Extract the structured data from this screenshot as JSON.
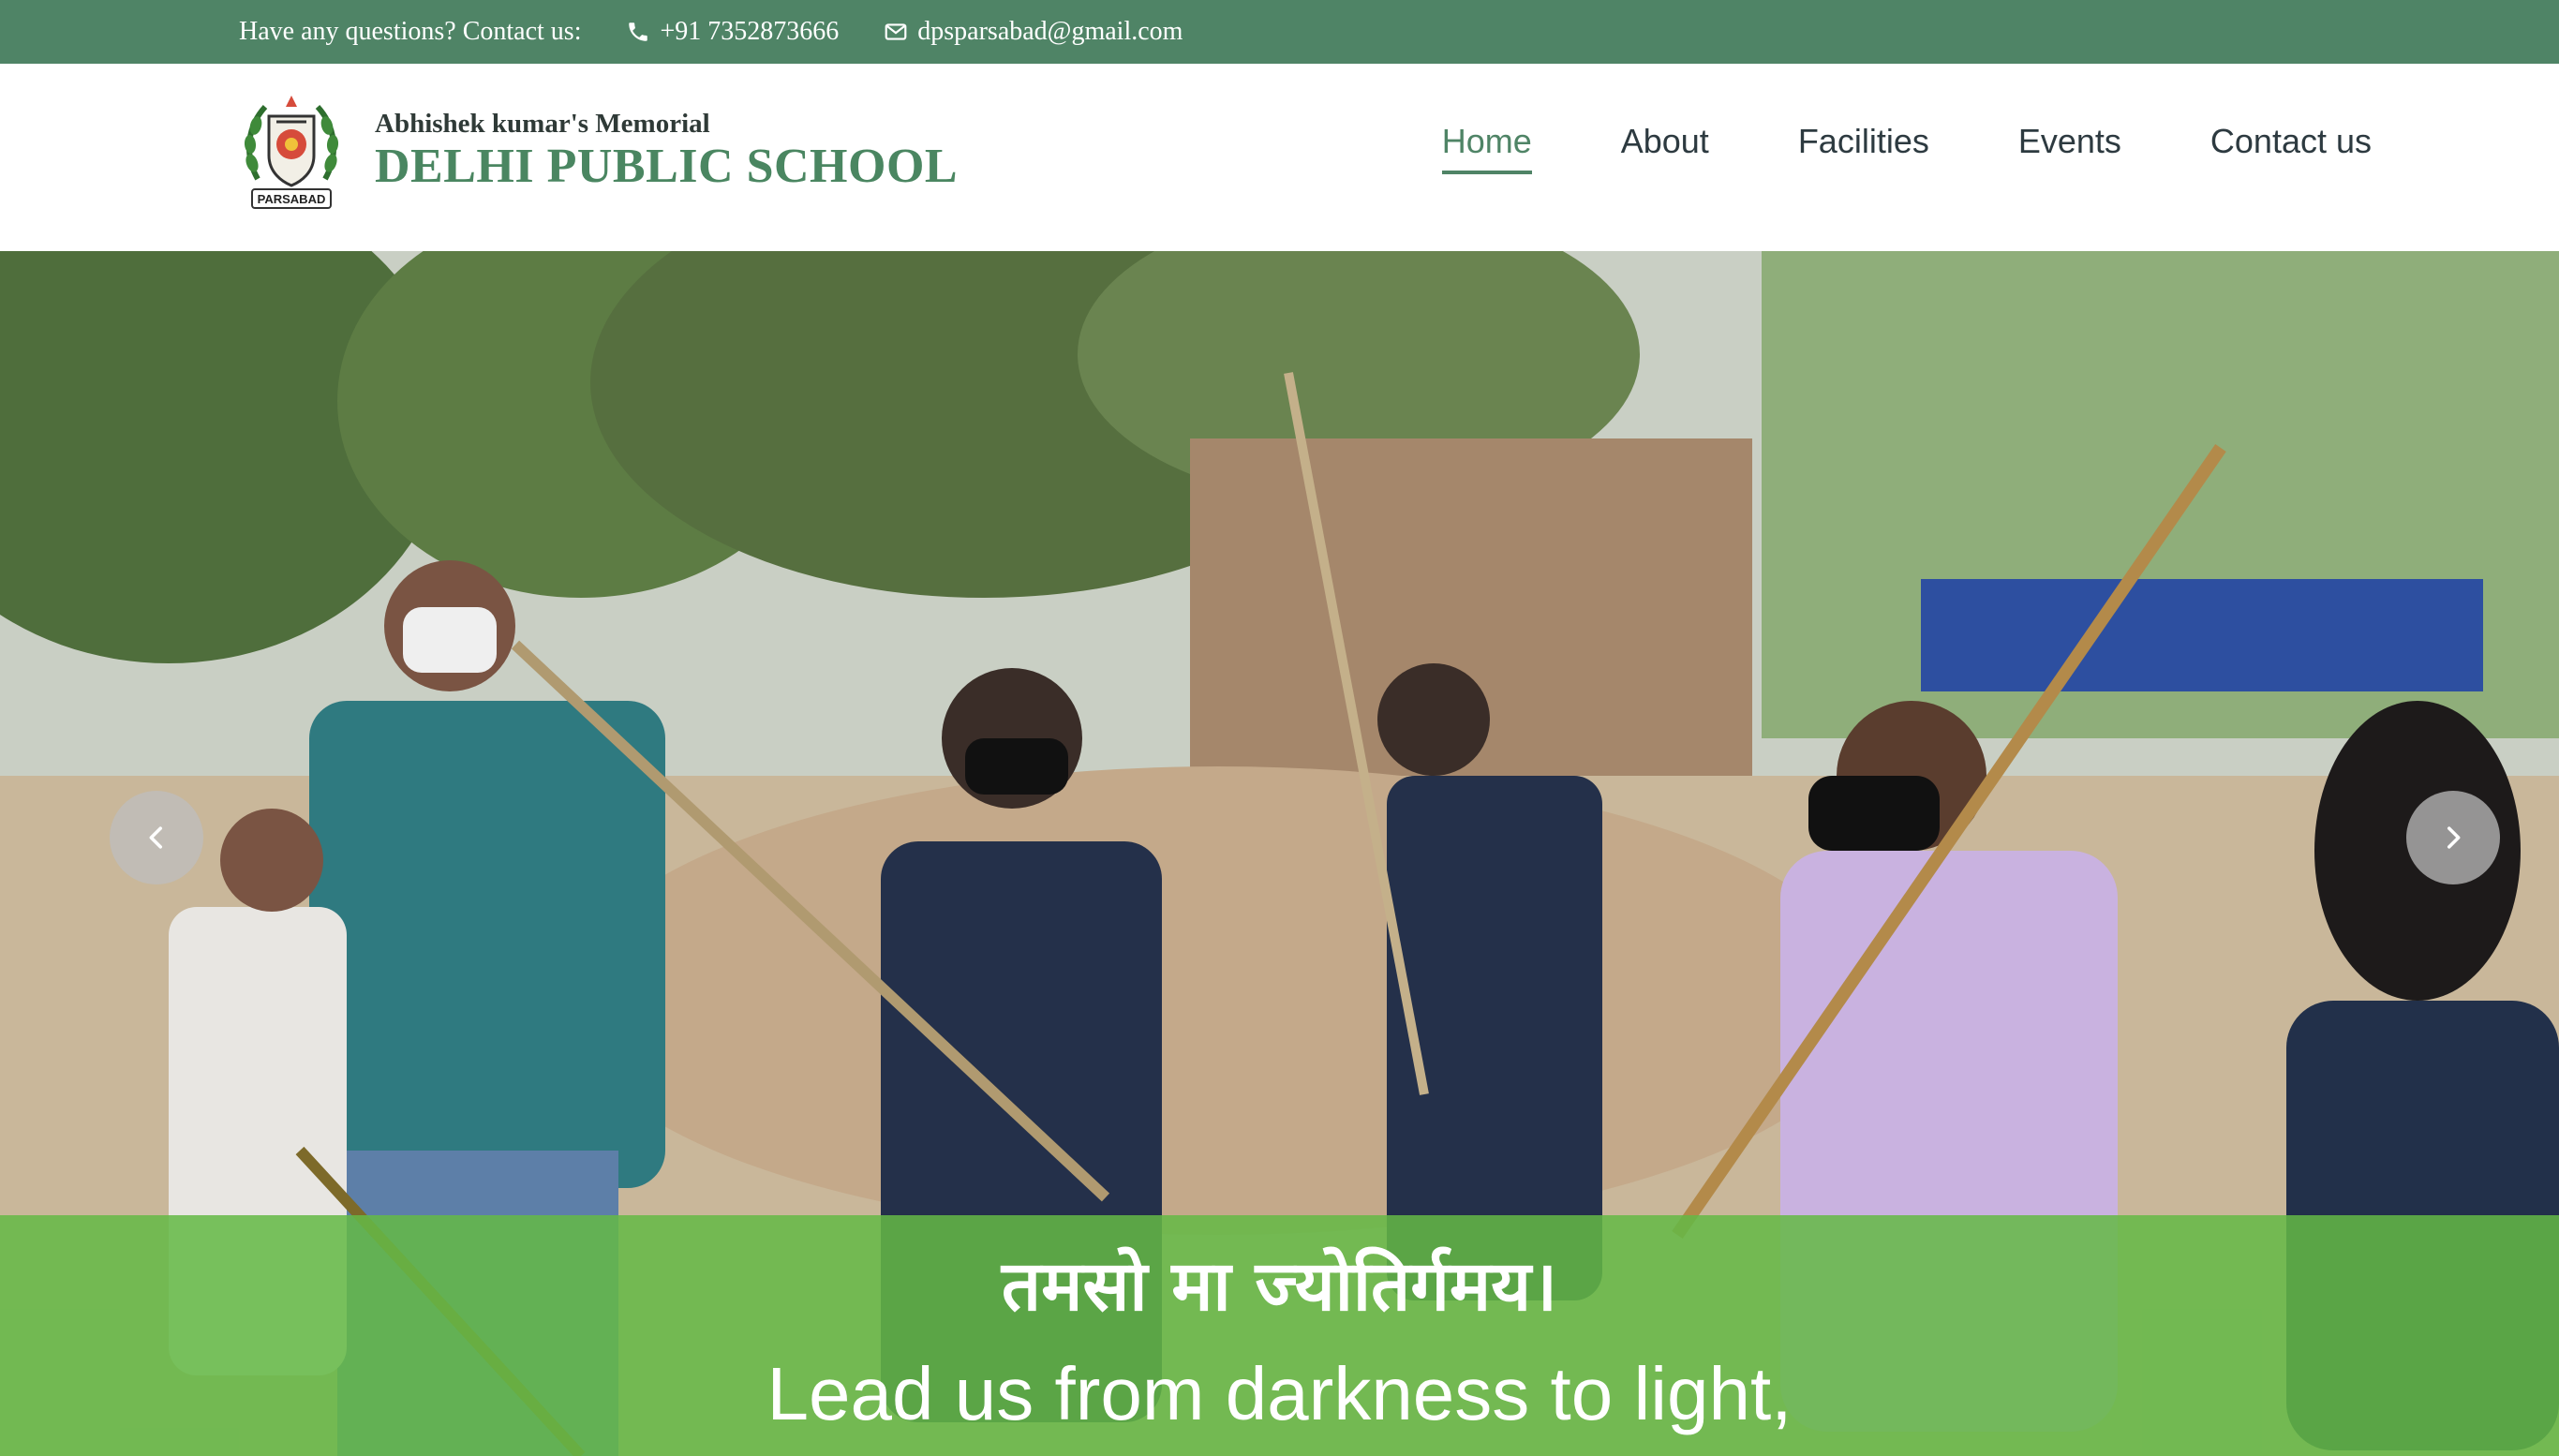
{
  "topbar": {
    "question": "Have any questions? Contact us:",
    "phone": "+91 7352873666",
    "email": "dpsparsabad@gmail.com",
    "phone_icon": "phone-icon",
    "email_icon": "envelope-icon"
  },
  "header": {
    "logo_text": "PARSABAD",
    "brand_small": "Abhishek kumar's Memorial",
    "brand_big": "DELHI PUBLIC SCHOOL"
  },
  "nav": {
    "items": [
      {
        "label": "Home",
        "active": true
      },
      {
        "label": "About",
        "active": false
      },
      {
        "label": "Facilities",
        "active": false
      },
      {
        "label": "Events",
        "active": false
      },
      {
        "label": "Contact us",
        "active": false
      }
    ]
  },
  "hero": {
    "caption_sanskrit": "तमसो मा ज्योतिर्गमय।",
    "caption_english": "Lead us from darkness to light,",
    "prev_icon": "chevron-left-icon",
    "next_icon": "chevron-right-icon"
  },
  "colors": {
    "topbar": "#4f8466",
    "brand": "#4a8661",
    "caption_overlay": "#64b946",
    "nav_text": "#2d3a40"
  }
}
